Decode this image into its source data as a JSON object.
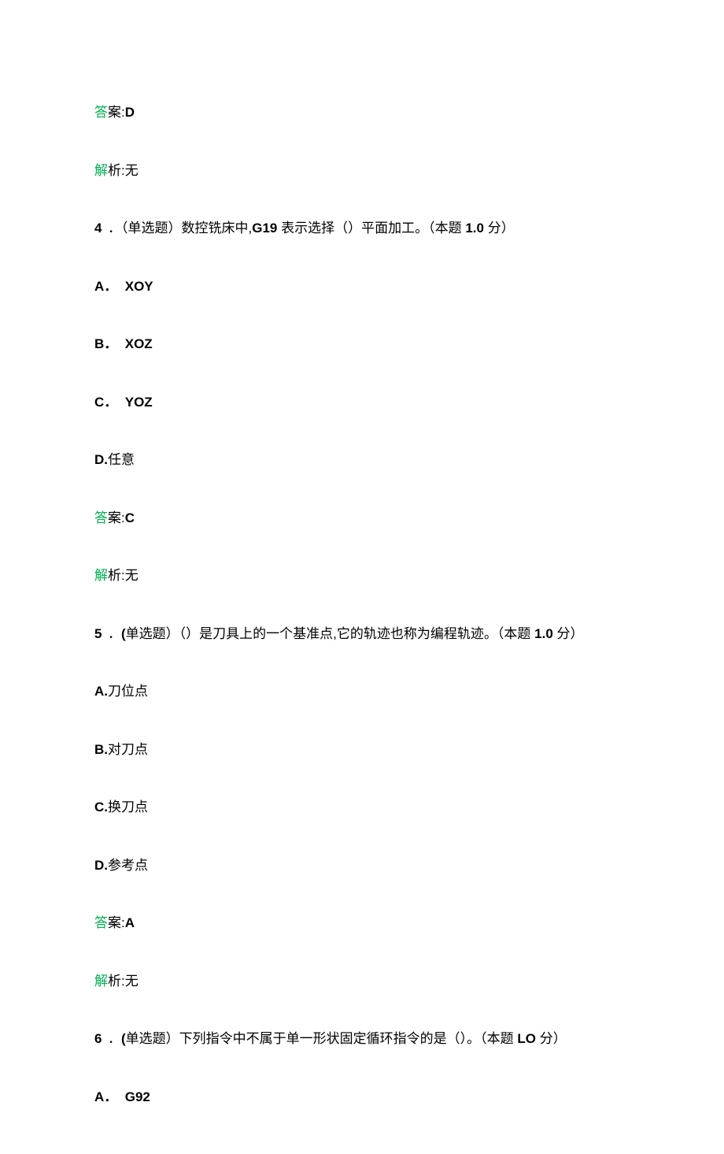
{
  "labels": {
    "answer_prefix_cn": "答",
    "answer_prefix_rest": "案:",
    "explain_prefix_cn": "解",
    "explain_prefix_rest": "析:无"
  },
  "q3": {
    "answer_value": "D"
  },
  "q4": {
    "number": "4",
    "dot": "．",
    "type_open": "（单选题）",
    "stem_a": "数控铣床中,",
    "stem_b": "G19",
    "stem_c": " 表示选择（）平面加工。",
    "points": "（本题 ",
    "points_val": "1.0",
    "points_suffix": " 分）",
    "optA_label": "A．",
    "optA_val": "XOY",
    "optB_label": "B．",
    "optB_val": "XOZ",
    "optC_label": "C．",
    "optC_val": "YOZ",
    "optD_label": "D.",
    "optD_val": "任意",
    "answer_value": "C"
  },
  "q5": {
    "number": "5",
    "dot": "．",
    "type_open": "(",
    "type_text": "单选题）",
    "stem": "（）是刀具上的一个基准点,它的轨迹也称为编程轨迹。",
    "points": "（本题 ",
    "points_val": "1.0",
    "points_suffix": " 分）",
    "optA_label": "A.",
    "optA_val": "刀位点",
    "optB_label": "B.",
    "optB_val": "对刀点",
    "optC_label": "C.",
    "optC_val": "换刀点",
    "optD_label": "D.",
    "optD_val": "参考点",
    "answer_value": "A"
  },
  "q6": {
    "number": "6",
    "dot": "．",
    "type_open": "(",
    "type_text": "单选题）",
    "stem": "下列指令中不属于单一形状固定循环指令的是（）。",
    "points": "（本题 ",
    "points_val": "LO",
    "points_suffix": " 分）",
    "optA_label": "A．",
    "optA_val": "G92"
  }
}
